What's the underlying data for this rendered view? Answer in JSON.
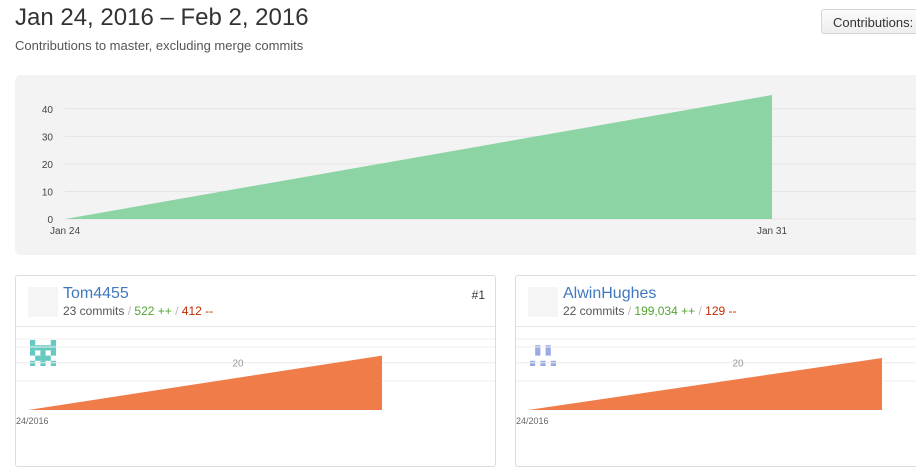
{
  "header": {
    "title": "Jan 24, 2016 – Feb 2, 2016",
    "subtitle": "Contributions to master, excluding merge commits",
    "contributions_button": "Contributions:"
  },
  "main_chart": {
    "chart_data": {
      "type": "area",
      "x": [
        "Jan 24",
        "Jan 31"
      ],
      "y_ticks": [
        0,
        10,
        20,
        30,
        40
      ],
      "ylim": [
        0,
        45
      ],
      "series": [
        {
          "values": [
            0,
            45
          ]
        }
      ],
      "x_tick_labels": [
        "Jan 24",
        "Jan 31"
      ],
      "color": "#8cd4a4",
      "grid": true
    }
  },
  "contributors": [
    {
      "username": "Tom4455",
      "commits": "23 commits",
      "additions": "522 ++",
      "deletions": "412 --",
      "rank": "#1",
      "avatar_color": "#63c9c1",
      "chart_data": {
        "type": "area",
        "x_tick_labels": [
          "24/2016"
        ],
        "y_ticks": [
          20
        ],
        "ylim": [
          0,
          33
        ],
        "series": [
          {
            "values": [
              0,
              23
            ]
          }
        ],
        "color": "#f07d49"
      }
    },
    {
      "username": "AlwinHughes",
      "commits": "22 commits",
      "additions": "199,034 ++",
      "deletions": "129 --",
      "rank": "",
      "avatar_color": "#98a9e3",
      "chart_data": {
        "type": "area",
        "x_tick_labels": [
          "24/2016"
        ],
        "y_ticks": [
          20
        ],
        "ylim": [
          0,
          33
        ],
        "series": [
          {
            "values": [
              0,
              22
            ]
          }
        ],
        "color": "#f07d49"
      }
    }
  ],
  "separators": {
    "slash": "/"
  }
}
